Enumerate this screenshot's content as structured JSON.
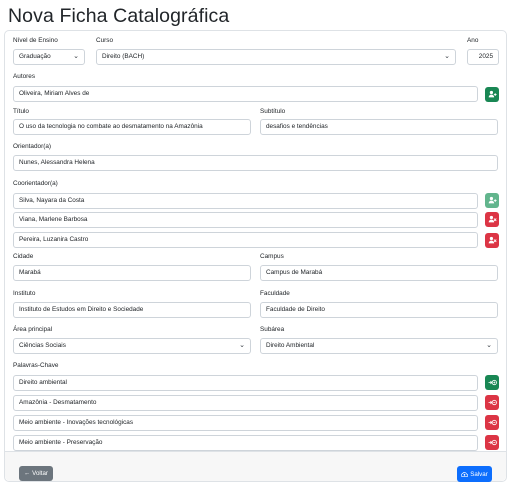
{
  "page": {
    "title": "Nova Ficha Catalográfica"
  },
  "form": {
    "nivel_label": "Nível de Ensino",
    "nivel_value": "Graduação",
    "curso_label": "Curso",
    "curso_value": "Direito (BACH)",
    "ano_label": "Ano",
    "ano_value": "2025",
    "autores_label": "Autores",
    "autores": [
      "Oliveira, Miriam Alves de"
    ],
    "titulo_label": "Título",
    "titulo_value": "O uso da tecnologia no combate ao desmatamento na Amazônia",
    "subtitulo_label": "Subtítulo",
    "subtitulo_value": "desafios e tendências",
    "orientador_label": "Orientador(a)",
    "orientador_value": "Nunes, Alessandra Helena",
    "coorientador_label": "Coorientador(a)",
    "coorientadores": [
      "Silva, Nayara da Costa",
      "Viana, Marlene Barbosa",
      "Pereira, Luzanira Castro"
    ],
    "cidade_label": "Cidade",
    "cidade_value": "Marabá",
    "campus_label": "Campus",
    "campus_value": "Campus de Marabá",
    "instituto_label": "Instituto",
    "instituto_value": "Instituto de Estudos em Direito e Sociedade",
    "faculdade_label": "Faculdade",
    "faculdade_value": "Faculdade de Direito",
    "area_label": "Área principal",
    "area_value": "Ciências Sociais",
    "subarea_label": "Subárea",
    "subarea_value": "Direito Ambiental",
    "palavras_label": "Palavras-Chave",
    "palavras": [
      "Direito ambiental",
      "Amazônia - Desmatamento",
      "Meio ambiente - Inovações tecnológicas",
      "Meio ambiente - Preservação"
    ]
  },
  "footer": {
    "back_label": "Voltar",
    "save_label": "Salvar"
  },
  "colors": {
    "success": "#198754",
    "danger": "#dc3545",
    "secondary": "#6c757d",
    "primary": "#0d6efd"
  },
  "icons": {
    "add_person": "person-plus-icon",
    "remove_person": "person-remove-icon",
    "add_keyword": "keyword-add-icon",
    "remove_keyword": "keyword-remove-icon",
    "back": "arrow-left-icon",
    "save": "cloud-upload-icon"
  }
}
